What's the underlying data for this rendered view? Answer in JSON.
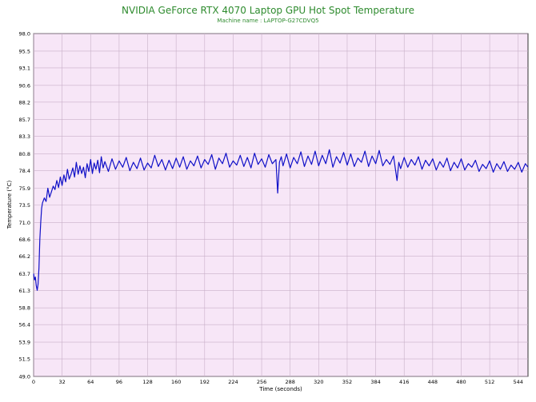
{
  "chart_data": {
    "type": "line",
    "title": "NVIDIA GeForce RTX 4070 Laptop GPU Hot Spot Temperature",
    "subtitle": "Machine name : LAPTOP-G27CDVQ5",
    "xlabel": "Time (seconds)",
    "ylabel": "Temperature (°C)",
    "xlim": [
      0,
      555
    ],
    "ylim": [
      49.0,
      98.0
    ],
    "xticks": [
      "0",
      "32",
      "64",
      "96",
      "128",
      "160",
      "192",
      "224",
      "256",
      "288",
      "320",
      "352",
      "384",
      "416",
      "448",
      "480",
      "512",
      "544"
    ],
    "yticks": [
      "98.0",
      "95.5",
      "93.1",
      "90.6",
      "88.2",
      "85.7",
      "83.3",
      "80.8",
      "78.4",
      "75.9",
      "73.5",
      "71.0",
      "68.6",
      "66.2",
      "63.7",
      "61.3",
      "58.8",
      "56.4",
      "53.9",
      "51.5",
      "49.0"
    ],
    "grid": true,
    "colors": {
      "plot_background": "#f7e6f7",
      "grid": "#c8b0c8",
      "line": "#1010c8",
      "title": "#2e8b2e"
    },
    "series": [
      {
        "name": "",
        "x": [
          0,
          1,
          2,
          3,
          4,
          5,
          6,
          7,
          8,
          9,
          10,
          12,
          14,
          16,
          18,
          20,
          22,
          24,
          26,
          28,
          30,
          32,
          34,
          36,
          38,
          40,
          42,
          44,
          46,
          48,
          50,
          52,
          54,
          56,
          58,
          60,
          62,
          64,
          66,
          68,
          70,
          72,
          74,
          76,
          78,
          80,
          84,
          88,
          92,
          96,
          100,
          104,
          108,
          112,
          116,
          120,
          124,
          128,
          132,
          136,
          140,
          144,
          148,
          152,
          156,
          160,
          164,
          168,
          172,
          176,
          180,
          184,
          188,
          192,
          196,
          200,
          204,
          208,
          212,
          216,
          220,
          224,
          228,
          232,
          236,
          240,
          244,
          248,
          252,
          256,
          260,
          264,
          268,
          272,
          274,
          276,
          278,
          280,
          284,
          288,
          292,
          296,
          300,
          304,
          308,
          312,
          316,
          320,
          324,
          328,
          332,
          336,
          340,
          344,
          348,
          352,
          356,
          360,
          364,
          368,
          372,
          376,
          380,
          384,
          388,
          392,
          396,
          400,
          404,
          408,
          410,
          412,
          416,
          420,
          424,
          428,
          432,
          436,
          440,
          444,
          448,
          452,
          456,
          460,
          464,
          468,
          472,
          476,
          480,
          484,
          488,
          492,
          496,
          500,
          504,
          508,
          512,
          516,
          520,
          524,
          528,
          532,
          536,
          540,
          544,
          548,
          552,
          555
        ],
        "values": [
          63.7,
          62.8,
          63.2,
          62.0,
          61.3,
          62.2,
          64.5,
          68.6,
          71.0,
          73.0,
          73.8,
          74.5,
          74.0,
          75.9,
          74.6,
          75.4,
          76.2,
          75.7,
          77.0,
          76.0,
          77.5,
          76.3,
          77.8,
          76.8,
          78.6,
          77.2,
          77.9,
          78.8,
          77.5,
          79.6,
          77.9,
          79.1,
          78.0,
          78.9,
          77.4,
          79.4,
          78.3,
          80.0,
          78.0,
          79.5,
          78.6,
          79.9,
          78.1,
          80.4,
          78.8,
          79.7,
          78.3,
          80.1,
          78.6,
          79.8,
          78.9,
          80.3,
          78.4,
          79.6,
          78.7,
          80.2,
          78.5,
          79.5,
          78.8,
          80.6,
          79.0,
          80.0,
          78.5,
          79.9,
          78.7,
          80.2,
          78.9,
          80.4,
          78.6,
          79.8,
          79.1,
          80.5,
          78.8,
          80.0,
          79.3,
          80.7,
          78.6,
          80.2,
          79.4,
          80.9,
          78.9,
          79.8,
          79.2,
          80.6,
          79.0,
          80.3,
          78.8,
          80.9,
          79.3,
          80.1,
          78.9,
          80.7,
          79.4,
          80.0,
          75.2,
          79.6,
          80.4,
          79.1,
          80.8,
          78.8,
          80.3,
          79.4,
          81.1,
          79.0,
          80.5,
          79.3,
          81.2,
          79.1,
          80.6,
          79.4,
          81.4,
          78.9,
          80.4,
          79.5,
          81.0,
          79.2,
          80.8,
          79.0,
          80.2,
          79.6,
          81.2,
          79.0,
          80.5,
          79.4,
          81.3,
          79.1,
          80.0,
          79.3,
          80.5,
          77.0,
          79.6,
          78.7,
          80.3,
          78.9,
          80.0,
          79.2,
          80.4,
          78.6,
          79.9,
          79.1,
          80.1,
          78.5,
          79.7,
          78.9,
          80.2,
          78.4,
          79.6,
          78.8,
          80.1,
          78.5,
          79.4,
          78.9,
          79.9,
          78.3,
          79.3,
          78.7,
          79.8,
          78.2,
          79.4,
          78.6,
          79.7,
          78.3,
          79.2,
          78.6,
          79.6,
          78.2,
          79.4,
          78.9
        ]
      }
    ]
  }
}
